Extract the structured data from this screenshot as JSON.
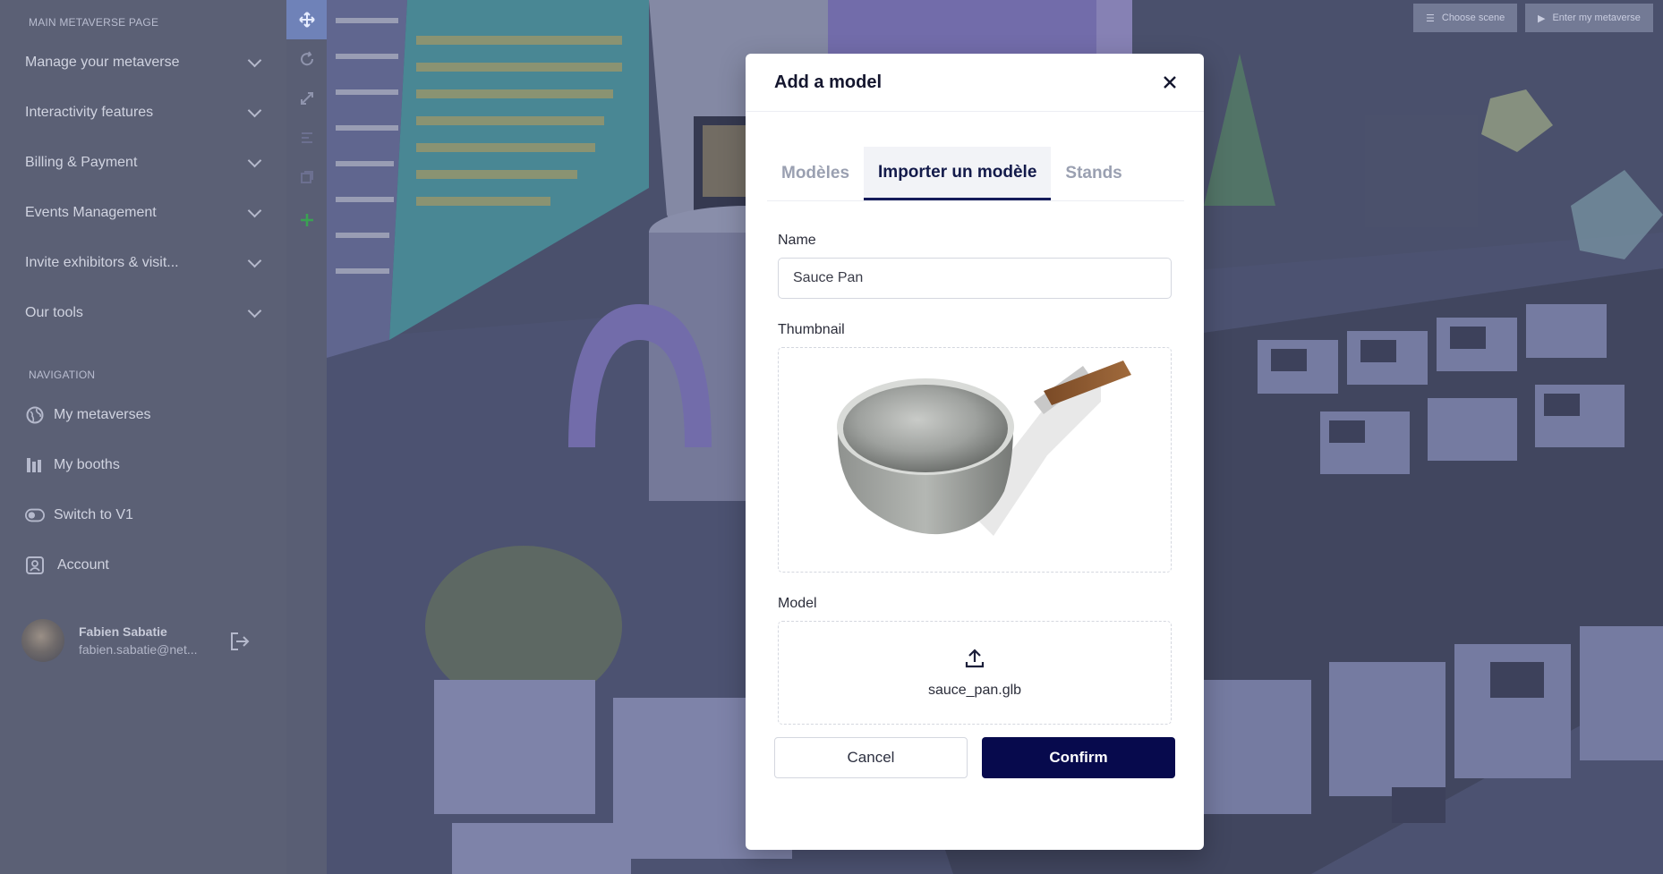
{
  "sidebar": {
    "main_title": "MAIN METAVERSE PAGE",
    "menu": [
      {
        "label": "Manage your metaverse"
      },
      {
        "label": "Interactivity features"
      },
      {
        "label": "Billing & Payment"
      },
      {
        "label": "Events Management"
      },
      {
        "label": "Invite exhibitors & visit..."
      },
      {
        "label": "Our tools"
      }
    ],
    "nav_title": "NAVIGATION",
    "nav": [
      {
        "label": "My metaverses",
        "icon": "globe-icon"
      },
      {
        "label": "My booths",
        "icon": "booth-icon"
      },
      {
        "label": "Switch to V1",
        "icon": "toggle-icon"
      },
      {
        "label": "Account",
        "icon": "account-icon"
      }
    ],
    "user": {
      "name": "Fabien Sabatie",
      "email": "fabien.sabatie@net..."
    }
  },
  "scene": {
    "choose_scene": "Choose scene",
    "enter_metaverse": "Enter my metaverse"
  },
  "modal": {
    "title": "Add a model",
    "tabs": [
      {
        "label": "Modèles",
        "active": false
      },
      {
        "label": "Importer un modèle",
        "active": true
      },
      {
        "label": "Stands",
        "active": false
      }
    ],
    "name_label": "Name",
    "name_value": "Sauce Pan",
    "thumbnail_label": "Thumbnail",
    "model_label": "Model",
    "model_file": "sauce_pan.glb",
    "cancel": "Cancel",
    "confirm": "Confirm"
  },
  "colors": {
    "primary": "#070a4d",
    "sidebar_bg": "#5b6075",
    "tool_active": "#6f82b8",
    "add_green": "#3aa152"
  }
}
